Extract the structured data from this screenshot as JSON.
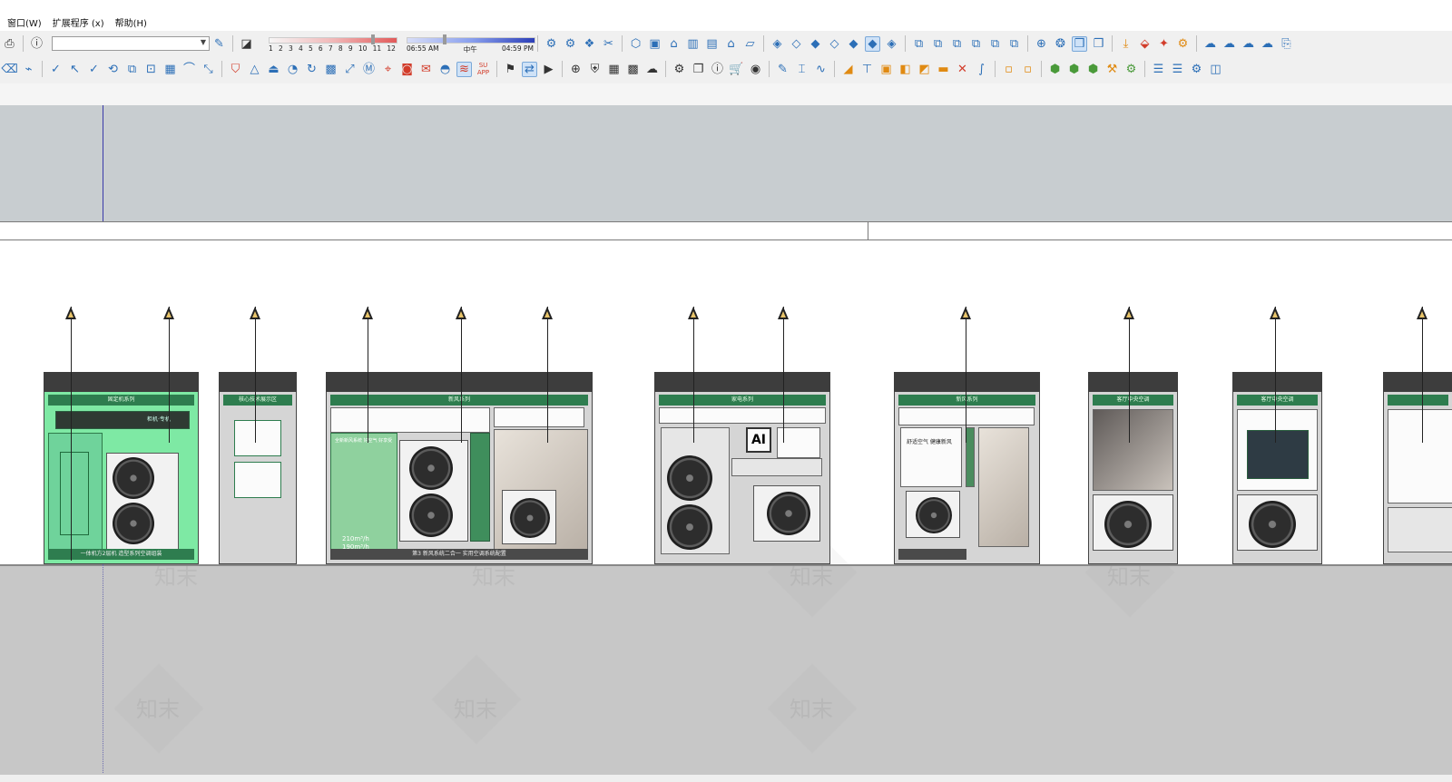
{
  "menu": {
    "items": [
      "窗口(W)",
      "扩展程序 (x)",
      "帮助(H)"
    ]
  },
  "toolbar": {
    "layer_select_value": "",
    "shadow_months": [
      "1",
      "2",
      "3",
      "4",
      "5",
      "6",
      "7",
      "8",
      "9",
      "10",
      "11",
      "12"
    ],
    "shadow_time_start": "06:55 AM",
    "shadow_time_mid": "中午",
    "shadow_time_end": "04:59 PM",
    "su_app_label": "SU",
    "su_app_sub": "APP"
  },
  "canvas": {
    "watermark_text": "知末",
    "booths": [
      {
        "title": "固定机系列",
        "base": "一体机方2层机 造型系列空调组装",
        "side_a": "柜机·专机",
        "bottom_text": "一体机"
      },
      {
        "title": "核心技术展示区",
        "base": ""
      },
      {
        "title": "新风系列",
        "base": "第3 新风系统二合一 实用空调系统配置",
        "big_text_1": "210m³/h",
        "big_text_2": "190m³/h",
        "tagline": "全新新风系统  好空气  好享受"
      },
      {
        "title": "家电系列",
        "base": "",
        "ai_label": "AI"
      },
      {
        "title": "新风系列",
        "base": "",
        "tagline": "舒适空气  健康新风"
      },
      {
        "title": "客厅中央空调",
        "base": ""
      },
      {
        "title": "客厅中央空调",
        "base": ""
      },
      {
        "title": "",
        "base": ""
      }
    ]
  }
}
